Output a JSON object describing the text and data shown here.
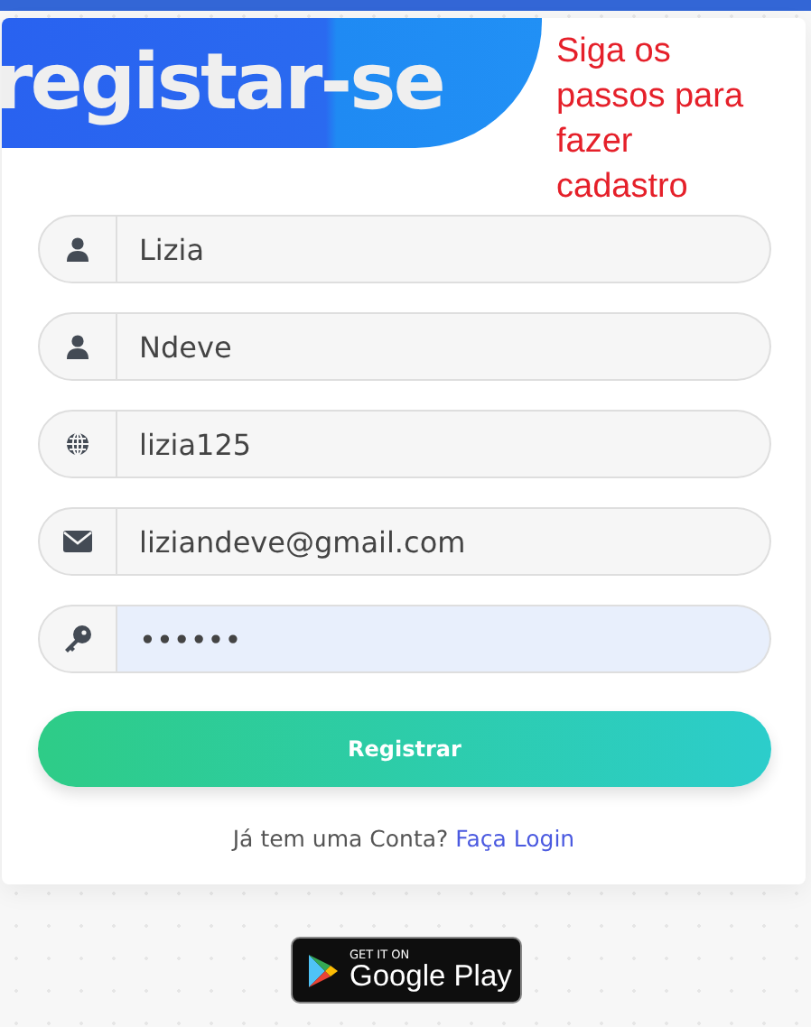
{
  "header": {
    "title": "registar-se",
    "subtitle": "Siga os passos para fazer cadastro"
  },
  "fields": [
    {
      "kind": "person",
      "value": "Lizia",
      "focused": false
    },
    {
      "kind": "person",
      "value": "Ndeve",
      "focused": false
    },
    {
      "kind": "globe",
      "value": "lizia125",
      "focused": false
    },
    {
      "kind": "mail",
      "value": "liziandeve@gmail.com",
      "focused": false
    },
    {
      "kind": "key",
      "value": "••••••",
      "focused": true
    }
  ],
  "submit": "Registrar",
  "login_prompt": {
    "text": "Já tem uma Conta?",
    "link": "Faça Login"
  },
  "store_badge": {
    "small": "GET IT ON",
    "large": "Google Play"
  }
}
